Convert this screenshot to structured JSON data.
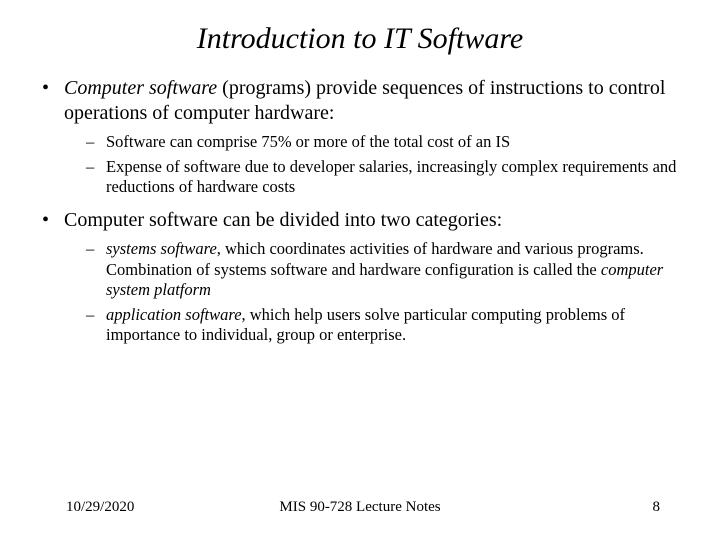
{
  "title": "Introduction to IT Software",
  "b1": {
    "lead_ital": "Computer software",
    "lead_rest": " (programs) provide sequences of instructions to control operations of computer hardware:",
    "sub1": "Software can comprise 75% or more of the total cost of an IS",
    "sub2": "Expense of software due to developer salaries, increasingly complex requirements and reductions of hardware costs"
  },
  "b2": {
    "text": "Computer software can be divided into two categories:",
    "sub1_ital": "systems software",
    "sub1_mid": ", which coordinates activities of hardware and various programs. Combination of systems software and hardware configuration is called the ",
    "sub1_ital2": "computer system platform",
    "sub2_ital": "application software",
    "sub2_rest": ", which help users solve particular computing problems of importance to individual, group or enterprise."
  },
  "footer": {
    "date": "10/29/2020",
    "center": "MIS 90-728 Lecture Notes",
    "page": "8"
  }
}
